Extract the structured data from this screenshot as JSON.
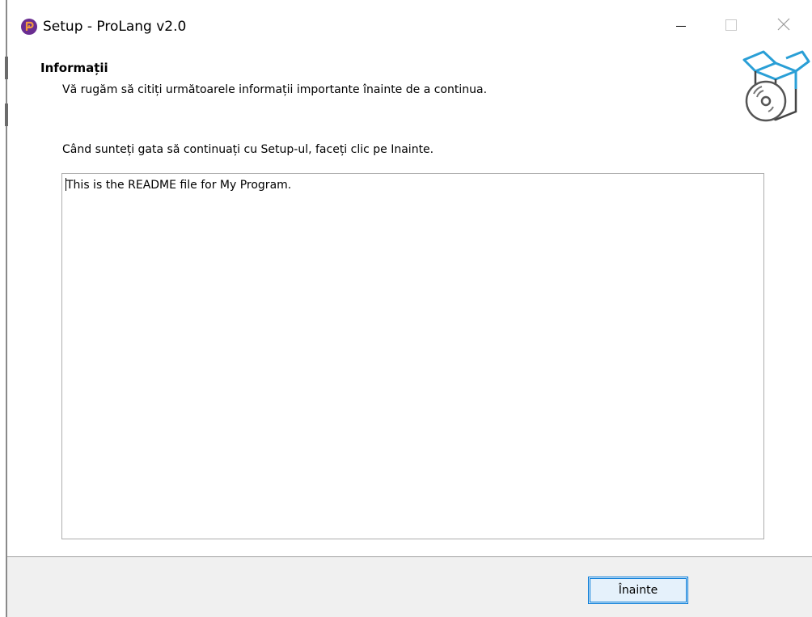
{
  "window": {
    "title": "Setup - ProLang v2.0",
    "app_icon": "prolang-logo-icon",
    "controls": {
      "minimize_icon": "minimize-icon",
      "maximize_icon": "maximize-icon",
      "close_icon": "close-icon"
    }
  },
  "header": {
    "title": "Informații",
    "description": "Vă rugăm să citiți următoarele informații importante înainte de a continua.",
    "image_icon": "software-box-disc-icon"
  },
  "main": {
    "instruction": "Când sunteți gata să continuați cu Setup-ul, faceți clic pe Inainte.",
    "readme_text": "This is the README file for My Program."
  },
  "footer": {
    "next_label": "Înainte"
  },
  "colors": {
    "accent": "#0078d7",
    "footer_bg": "#f0f0f0",
    "icon_purple": "#6a2d91",
    "icon_orange": "#f39c3d",
    "image_blue": "#2a9fd6"
  }
}
